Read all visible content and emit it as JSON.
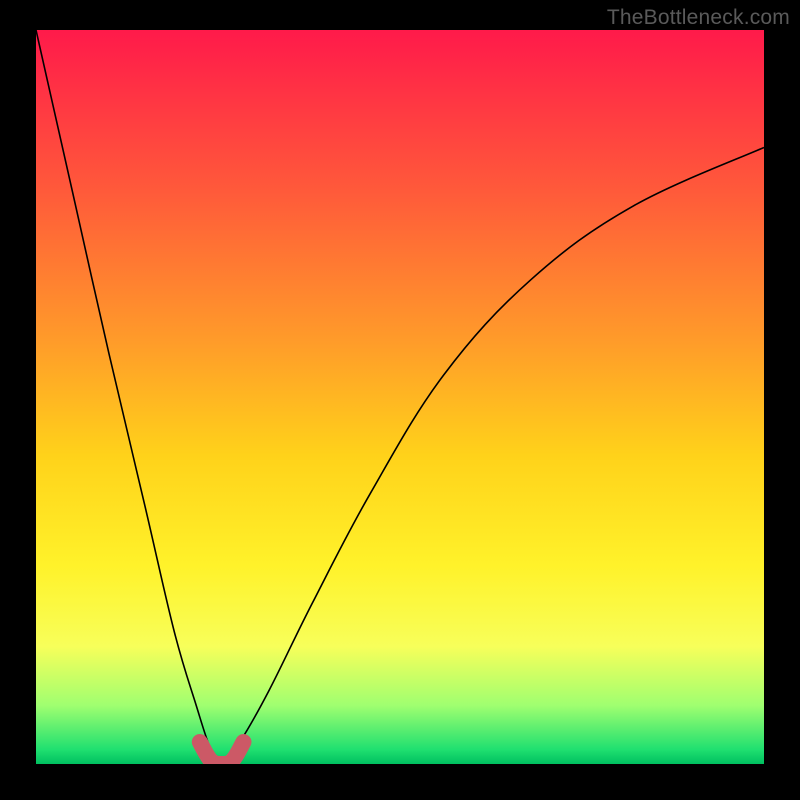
{
  "watermark": "TheBottleneck.com",
  "colors": {
    "background": "#000000",
    "gradient_top": "#ff1a4a",
    "gradient_bottom": "#00c060",
    "curve_stroke": "#000000",
    "notch_stroke": "#cc5966"
  },
  "chart_data": {
    "type": "line",
    "title": "",
    "xlabel": "",
    "ylabel": "",
    "xlim": [
      0,
      100
    ],
    "ylim": [
      0,
      100
    ],
    "grid": false,
    "legend": false,
    "description": "Single V-shaped bottleneck curve with minimum near x≈25. Left branch starts at the top-left corner and descends steeply to the minimum. Right branch rises from the minimum toward the upper right, flattening as it approaches the right edge. A thick rounded segment highlights the bottom of the V.",
    "series": [
      {
        "name": "left_branch",
        "x": [
          0,
          5,
          10,
          15,
          19,
          22,
          24,
          25.5
        ],
        "y": [
          100,
          78,
          56,
          35,
          18,
          8,
          2,
          0
        ]
      },
      {
        "name": "right_branch",
        "x": [
          25.5,
          28,
          32,
          38,
          46,
          56,
          68,
          82,
          100
        ],
        "y": [
          0,
          3,
          10,
          22,
          37,
          53,
          66,
          76,
          84
        ]
      }
    ],
    "highlight_notch": {
      "x": [
        22.5,
        24,
        25.5,
        27,
        28.5
      ],
      "y": [
        3,
        0.5,
        0,
        0.5,
        3
      ]
    }
  }
}
